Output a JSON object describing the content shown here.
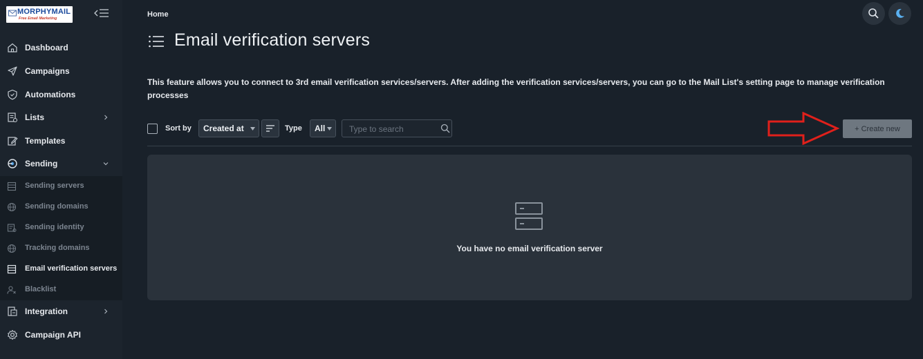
{
  "logo": {
    "name": "MORPHYMAIL",
    "tagline": "Free Email Marketing"
  },
  "sidebar": {
    "items": [
      {
        "label": "Dashboard",
        "icon": "home-icon"
      },
      {
        "label": "Campaigns",
        "icon": "paper-plane-icon"
      },
      {
        "label": "Automations",
        "icon": "shield-icon"
      },
      {
        "label": "Lists",
        "icon": "list-icon"
      },
      {
        "label": "Templates",
        "icon": "edit-icon"
      },
      {
        "label": "Sending",
        "icon": "sending-icon"
      },
      {
        "label": "Integration",
        "icon": "integration-icon"
      },
      {
        "label": "Campaign API",
        "icon": "gear-icon"
      }
    ],
    "sending_sub": [
      {
        "label": "Sending servers",
        "icon": "server-icon"
      },
      {
        "label": "Sending domains",
        "icon": "globe-icon"
      },
      {
        "label": "Sending identity",
        "icon": "id-card-icon"
      },
      {
        "label": "Tracking domains",
        "icon": "globe-icon"
      },
      {
        "label": "Email verification servers",
        "icon": "server-icon"
      },
      {
        "label": "Blacklist",
        "icon": "user-x-icon"
      }
    ]
  },
  "breadcrumb": "Home",
  "page_title": "Email verification servers",
  "description": "This feature allows you to connect to 3rd email verification services/servers. After adding the verification services/servers, you can go to the Mail List's setting page to manage verification processes",
  "toolbar": {
    "sort_by_label": "Sort by",
    "sort_value": "Created at",
    "type_label": "Type",
    "type_value": "All",
    "search_placeholder": "Type to search",
    "create_label": "+ Create new"
  },
  "empty_state": {
    "message": "You have no email verification server"
  },
  "colors": {
    "background": "#19212a",
    "sidebar": "#1c242d",
    "panel": "#2a323b",
    "arrow": "#e0201b",
    "create_button": "#6e7780"
  }
}
